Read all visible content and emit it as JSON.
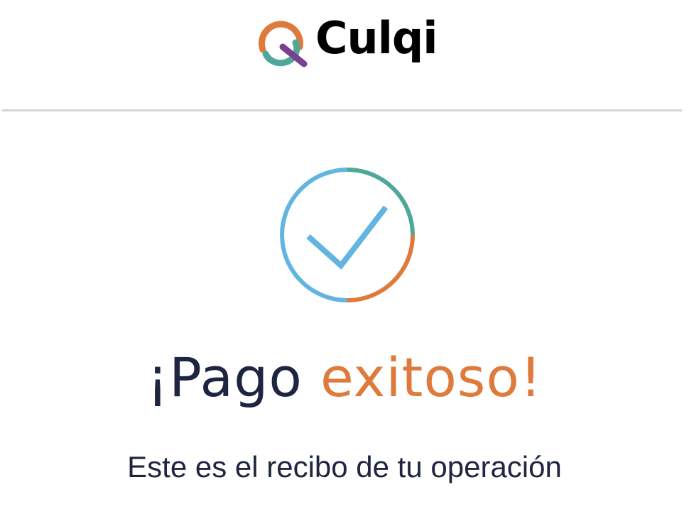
{
  "brand": {
    "name": "Culqi",
    "logo_icon": "culqi-q-logo-icon",
    "colors": {
      "orange": "#de7b3c",
      "teal": "#4fa79a",
      "purple": "#7b3f8f",
      "blue": "#62b5e0",
      "navy": "#1d2540"
    }
  },
  "status": {
    "icon": "checkmark-circle-icon",
    "title_prefix": "¡Pago",
    "title_highlight": "exitoso!",
    "subtitle": "Este es el recibo de tu operación"
  }
}
